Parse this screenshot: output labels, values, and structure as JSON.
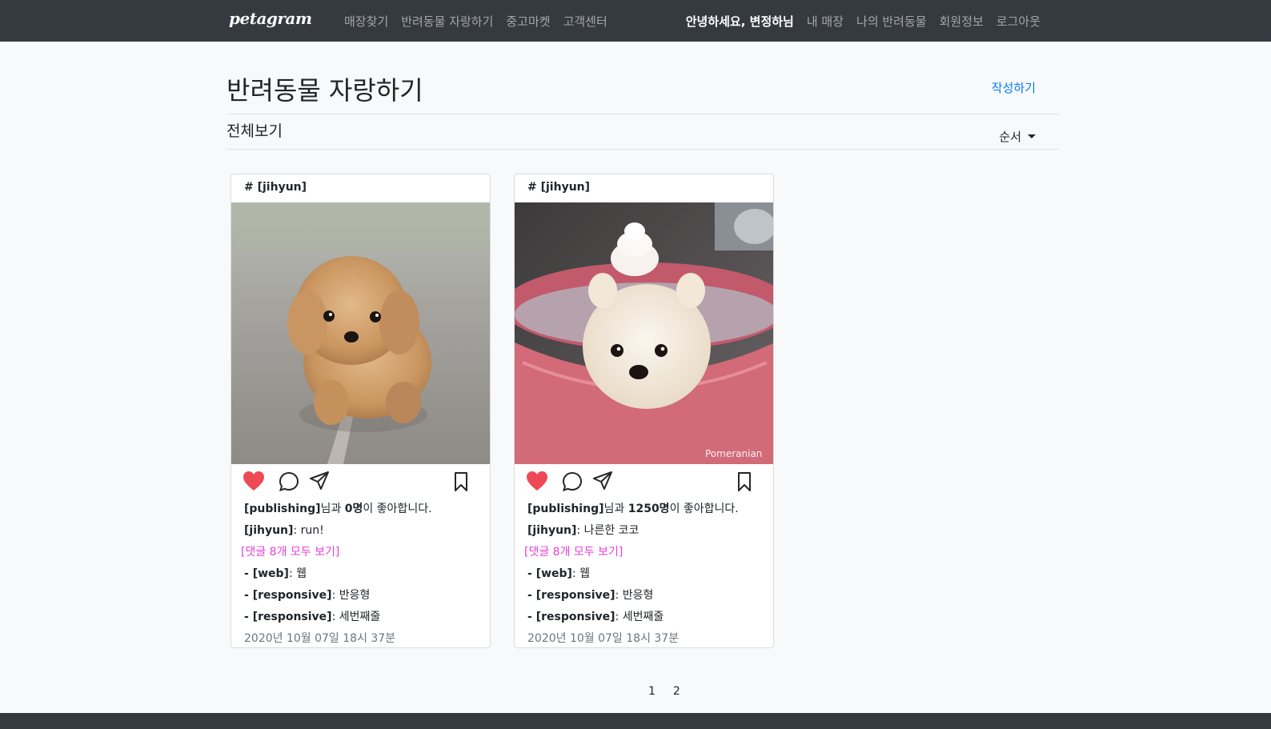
{
  "nav": {
    "brand": "petagram",
    "left_links": [
      "매장찾기",
      "반려동물 자랑하기",
      "중고마켓",
      "고객센터"
    ],
    "greeting": "안녕하세요, 변정하님",
    "right_links": [
      "내 매장",
      "나의 반려동물",
      "회원정보",
      "로그아웃"
    ]
  },
  "header": {
    "title": "반려동물 자랑하기",
    "write_label": "작성하기",
    "subtitle": "전체보기",
    "sort_label": "순서"
  },
  "posts": [
    {
      "author": "# [jihyun]",
      "like_user": "[publishing]",
      "like_mid": "님과 ",
      "like_count": "0명",
      "like_tail": "이 좋아합니다.",
      "caption_author": "[jihyun]",
      "caption_text": ": run!",
      "comments_link": "[댓글 8개 모두 보기]",
      "comments": [
        {
          "prefix": "- ",
          "user": "[web]",
          "text": ": 웹"
        },
        {
          "prefix": "- ",
          "user": "[responsive]",
          "text": ": 반응형"
        },
        {
          "prefix": "- ",
          "user": "[responsive]",
          "text": ": 세번째줄"
        }
      ],
      "date": "2020년 10월 07일 18시 37분"
    },
    {
      "author": "# [jihyun]",
      "like_user": "[publishing]",
      "like_mid": "님과 ",
      "like_count": "1250명",
      "like_tail": "이 좋아합니다.",
      "caption_author": "[jihyun]",
      "caption_text": ": 나른한 코코",
      "comments_link": "[댓글 8개 모두 보기]",
      "comments": [
        {
          "prefix": "- ",
          "user": "[web]",
          "text": ": 웹"
        },
        {
          "prefix": "- ",
          "user": "[responsive]",
          "text": ": 반응형"
        },
        {
          "prefix": "- ",
          "user": "[responsive]",
          "text": ": 세번째줄"
        }
      ],
      "date": "2020년 10월 07일 18시 37분",
      "image_watermark": "Pomeranian"
    }
  ],
  "pagination": [
    "1",
    "2"
  ],
  "colors": {
    "navbar": "#343a40",
    "link": "#007bff",
    "heart": "#ed4956",
    "comments_link": "#e83ed6"
  }
}
